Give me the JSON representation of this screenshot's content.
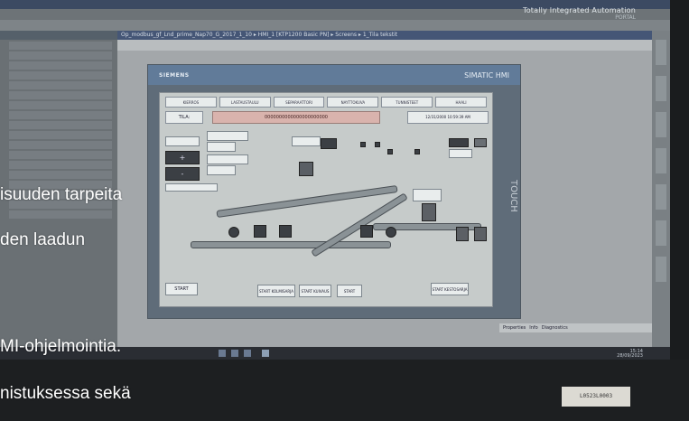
{
  "app": {
    "brand_line1": "Totally Integrated Automation",
    "brand_line2": "PORTAL"
  },
  "editor": {
    "breadcrumb": "Op_modbus_gf_Lnd_prime_Nap70_G_2017_1_10 ▸ HMI_1 [KTP1200 Basic PN] ▸ Screens ▸ 1_Tila tekstit"
  },
  "hmi": {
    "brand": "SIEMENS",
    "product": "SIMATIC HMI",
    "side_text": "TOUCH",
    "nav_buttons": [
      "KIERROS",
      "LASTAUSTAULU",
      "SEPARAATTORI",
      "NAYTTOKUVA",
      "TUNNISTEET",
      "HAALI"
    ],
    "tila_label": "TILA:",
    "tila_value": "0000000000000000000000",
    "date_value": "12/31/2000 10:59:39 AM",
    "buttons": {
      "plus": "+",
      "minus": "-",
      "start1": "START",
      "start2": "START KOLMISARJA",
      "start3": "START KUIVAUS",
      "start4": "START",
      "start5": "START KESTOSARJA"
    }
  },
  "panels": {
    "properties_tab": "Properties",
    "info_tab": "Info",
    "diagnostics_tab": "Diagnostics"
  },
  "taskbar": {
    "time": "15:14",
    "date": "28/09/2023"
  },
  "sticker": {
    "code": "L0523L0003"
  },
  "overlay_text": {
    "line1": "isuuden tarpeita",
    "line2": "den laadun",
    "line3": "MI-ohjelmointia.",
    "line4": "nistuksessa sekä"
  }
}
